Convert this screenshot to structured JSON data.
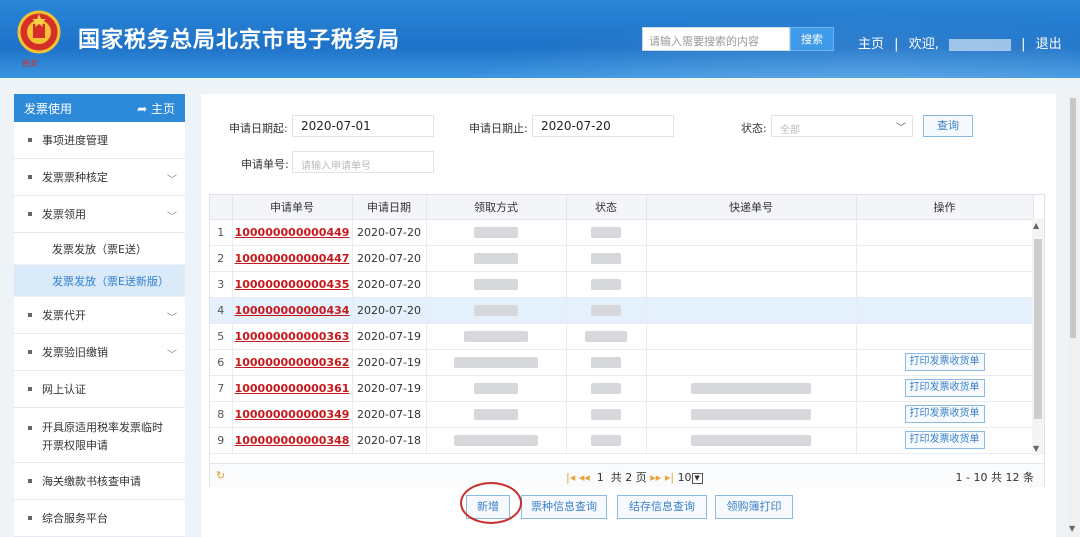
{
  "header": {
    "site_title": "国家税务总局北京市电子税务局",
    "search_placeholder": "请输入需要搜索的内容",
    "search_button": "搜索",
    "nav_home": "主页",
    "nav_welcome": "欢迎,",
    "nav_logout": "退出"
  },
  "sidebar": {
    "header_label": "发票使用",
    "header_home": "主页",
    "items": [
      {
        "label": "事项进度管理"
      },
      {
        "label": "发票票种核定"
      },
      {
        "label": "发票领用"
      },
      {
        "label": "发票发放（票E送）"
      },
      {
        "label": "发票发放（票E送新版）"
      },
      {
        "label": "发票代开"
      },
      {
        "label": "发票验旧缴销"
      },
      {
        "label": "网上认证"
      },
      {
        "label": "开具原适用税率发票临时"
      },
      {
        "label": "开票权限申请"
      },
      {
        "label": "海关缴款书核查申请"
      },
      {
        "label": "综合服务平台"
      }
    ]
  },
  "filters": {
    "start_label": "申请日期起:",
    "start_value": "2020-07-01",
    "end_label": "申请日期止:",
    "end_value": "2020-07-20",
    "status_label": "状态:",
    "status_value": "全部",
    "app_no_label": "申请单号:",
    "app_no_placeholder": "请输入申请单号",
    "query_button": "查询"
  },
  "table": {
    "headers": [
      "申请单号",
      "申请日期",
      "领取方式",
      "状态",
      "快递单号",
      "操作"
    ],
    "rows": [
      {
        "idx": "1",
        "no": "100000000000449",
        "date": "2020-07-20"
      },
      {
        "idx": "2",
        "no": "100000000000447",
        "date": "2020-07-20"
      },
      {
        "idx": "3",
        "no": "100000000000435",
        "date": "2020-07-20"
      },
      {
        "idx": "4",
        "no": "100000000000434",
        "date": "2020-07-20"
      },
      {
        "idx": "5",
        "no": "100000000000363",
        "date": "2020-07-19"
      },
      {
        "idx": "6",
        "no": "100000000000362",
        "date": "2020-07-19",
        "action": "打印发票收货单"
      },
      {
        "idx": "7",
        "no": "100000000000361",
        "date": "2020-07-19",
        "action": "打印发票收货单"
      },
      {
        "idx": "8",
        "no": "100000000000349",
        "date": "2020-07-18",
        "action": "打印发票收货单"
      },
      {
        "idx": "9",
        "no": "100000000000348",
        "date": "2020-07-18",
        "action": "打印发票收货单"
      }
    ]
  },
  "pager": {
    "current_page": "1",
    "total_pages": "共 2 页",
    "page_size": "10",
    "summary": "1 - 10   共 12 条"
  },
  "actions": {
    "add": "新增",
    "type_query": "票种信息查询",
    "stock_query": "结存信息查询",
    "print_book": "领购簿打印"
  },
  "colors": {
    "header_blue": "#1e73c8",
    "link_red": "#c7181c",
    "accent_blue": "#2d8ad9"
  }
}
